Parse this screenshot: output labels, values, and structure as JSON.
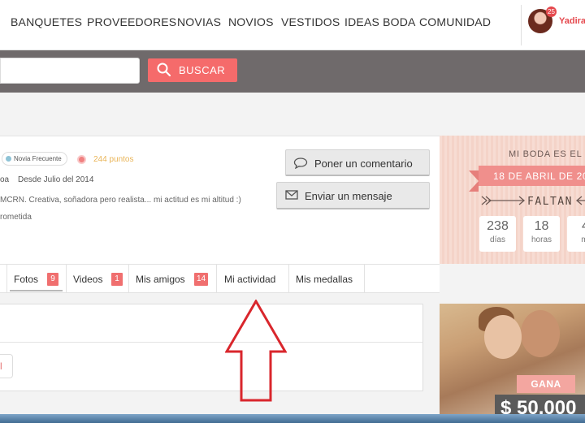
{
  "nav": {
    "items": [
      "BANQUETES",
      "PROVEEDORES",
      "NOVIAS",
      "NOVIOS",
      "VESTIDOS",
      "IDEAS BODA",
      "COMUNIDAD"
    ],
    "notifications": "25",
    "username": "Yadira"
  },
  "search": {
    "placeholder": "",
    "button_label": "BUSCAR",
    "button_color": "#f56b6b"
  },
  "profile": {
    "badge": "Novia Frecuente",
    "points": "244 puntos",
    "role_fragment": "oa",
    "since": "Desde Julio del 2014",
    "bio": "MCRN. Creativa, soñadora pero realista... mi actitud es mi altitud :)",
    "status": "rometida"
  },
  "actions": {
    "comment": "Poner un comentario",
    "message": "Enviar un mensaje"
  },
  "countdown": {
    "title": "MI BODA ES EL",
    "date": "18 DE ABRIL DE 20",
    "faltan": "FALTAN",
    "boxes": [
      {
        "num": "238",
        "unit": "días"
      },
      {
        "num": "18",
        "unit": "horas"
      },
      {
        "num": "4",
        "unit": "mi"
      }
    ]
  },
  "tabs": [
    {
      "label": "Fotos",
      "count": "9"
    },
    {
      "label": "Videos",
      "count": "1"
    },
    {
      "label": "Mis amigos",
      "count": "14"
    },
    {
      "label": "Mi actividad",
      "count": null
    },
    {
      "label": "Mis medallas",
      "count": null
    }
  ],
  "content": {
    "mini_button": "l"
  },
  "ad": {
    "gana": "GANA",
    "prize": "$ 50.000"
  },
  "colors": {
    "accent": "#f06f6f",
    "header_band": "#6f6a6b",
    "points": "#e9b457",
    "annotation": "#d9262c"
  }
}
